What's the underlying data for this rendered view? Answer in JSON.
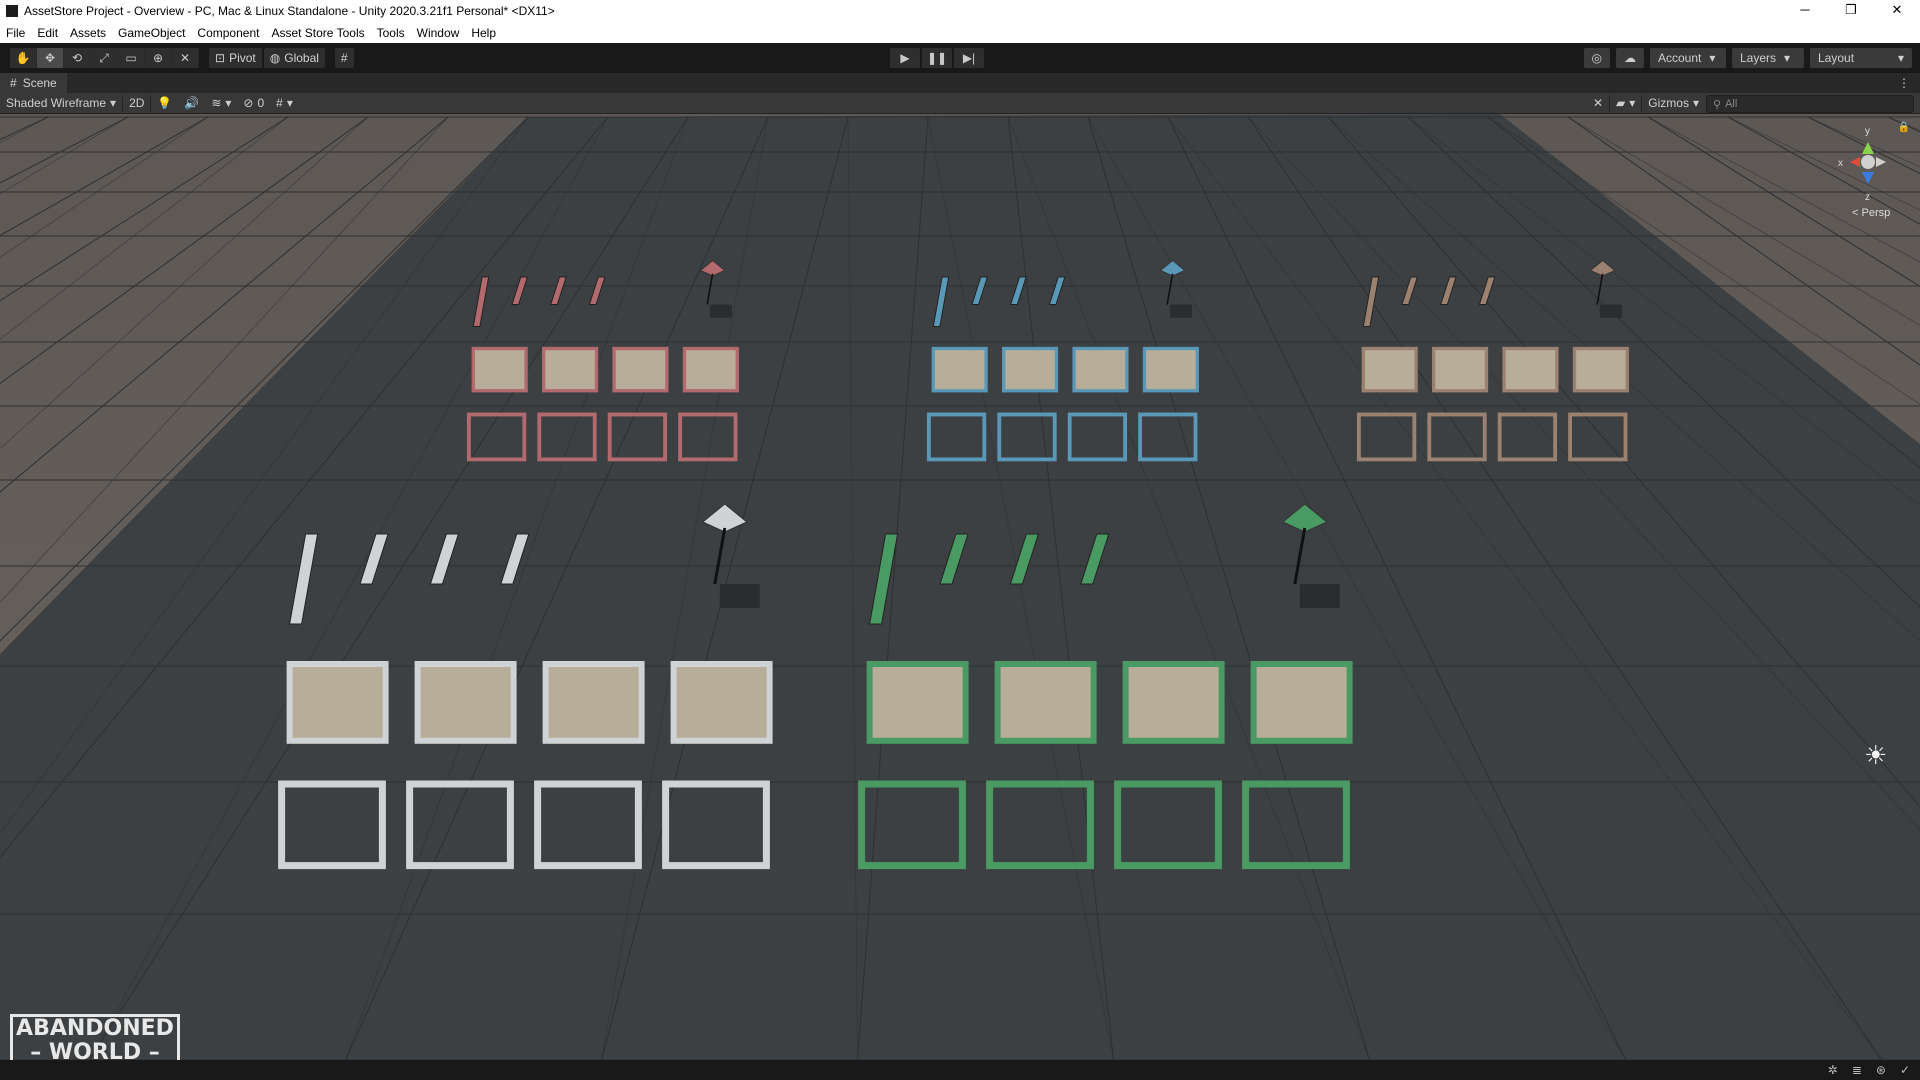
{
  "window": {
    "title": "AssetStore Project - Overview - PC, Mac & Linux Standalone - Unity 2020.3.21f1 Personal* <DX11>",
    "minimize": "─",
    "restore": "❐",
    "close": "✕"
  },
  "menu": [
    "File",
    "Edit",
    "Assets",
    "GameObject",
    "Component",
    "Asset Store Tools",
    "Tools",
    "Window",
    "Help"
  ],
  "toolbar": {
    "tools": [
      "hand-tool-icon",
      "move-tool-icon",
      "rotate-tool-icon",
      "scale-tool-icon",
      "rect-tool-icon",
      "transform-tool-icon",
      "custom-tool-icon"
    ],
    "pivot_label": "Pivot",
    "global_label": "Global",
    "account_label": "Account",
    "layers_label": "Layers",
    "layout_label": "Layout"
  },
  "scene_tab": {
    "label": "Scene"
  },
  "scene_bar": {
    "shading_mode": "Shaded Wireframe",
    "mode_2d": "2D",
    "hidden_count": "0",
    "gizmos_label": "Gizmos",
    "search_placeholder": "All"
  },
  "orientation_gizmo": {
    "y": "y",
    "x": "x",
    "z": "z",
    "projection": "Persp"
  },
  "logo": {
    "line1": "ABANDONED",
    "line2": "WORLD"
  },
  "asset_sets": [
    {
      "color": "#b36a6e"
    },
    {
      "color": "#5a98b8"
    },
    {
      "color": "#9b8170"
    },
    {
      "color": "#cfd3d6"
    },
    {
      "color": "#4a9a64"
    }
  ],
  "colors": {
    "toolbar_bg": "#191919",
    "panel_bg": "#383838",
    "ground": "#3d4042",
    "sky": "#5a5654"
  }
}
